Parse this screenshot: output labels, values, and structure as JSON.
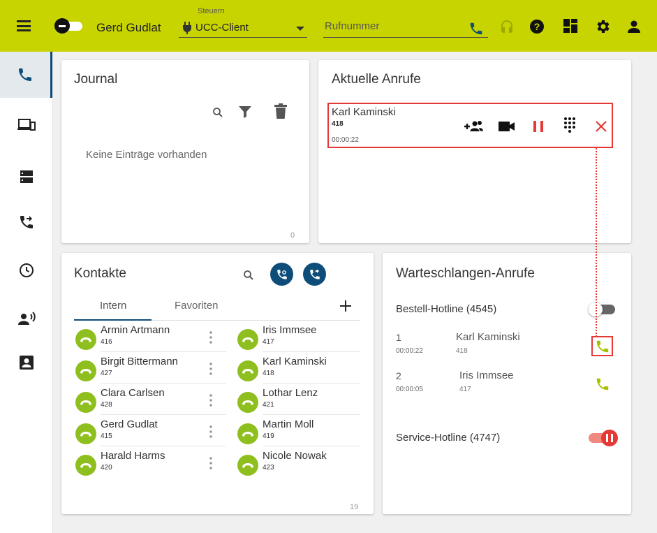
{
  "topbar": {
    "username": "Gerd Gudlat",
    "control_label": "Steuern",
    "control_value": "UCC-Client",
    "phone_placeholder": "Rufnummer"
  },
  "journal": {
    "title": "Journal",
    "empty_text": "Keine Einträge vorhanden",
    "count": "0"
  },
  "current_calls": {
    "title": "Aktuelle Anrufe",
    "call": {
      "name": "Karl Kaminski",
      "number": "418",
      "duration": "00:00:22"
    }
  },
  "contacts": {
    "title": "Kontakte",
    "tabs": [
      "Intern",
      "Favoriten"
    ],
    "count": "19",
    "items": [
      {
        "name": "Armin Artmann",
        "number": "416"
      },
      {
        "name": "Iris Immsee",
        "number": "417"
      },
      {
        "name": "Birgit Bittermann",
        "number": "427"
      },
      {
        "name": "Karl Kaminski",
        "number": "418"
      },
      {
        "name": "Clara Carlsen",
        "number": "428"
      },
      {
        "name": "Lothar Lenz",
        "number": "421"
      },
      {
        "name": "Gerd Gudlat",
        "number": "415"
      },
      {
        "name": "Martin Moll",
        "number": "419"
      },
      {
        "name": "Harald Harms",
        "number": "420"
      },
      {
        "name": "Nicole Nowak",
        "number": "423"
      }
    ]
  },
  "queue": {
    "title": "Warteschlangen-Anrufe",
    "hotlines": [
      {
        "name": "Bestell-Hotline (4545)",
        "calls": [
          {
            "position": "1",
            "wait": "00:00:22",
            "name": "Karl Kaminski",
            "ext": "418"
          },
          {
            "position": "2",
            "wait": "00:00:05",
            "name": "Iris Immsee",
            "ext": "417"
          }
        ]
      },
      {
        "name": "Service-Hotline (4747)"
      }
    ]
  },
  "colors": {
    "accent": "#c8d400",
    "primary": "#0e4c7a",
    "danger": "#e53935",
    "call_green": "#8fbf1f"
  }
}
